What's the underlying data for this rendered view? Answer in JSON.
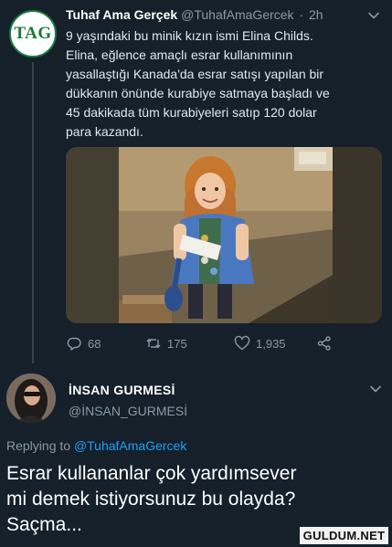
{
  "tweet1": {
    "avatar_text": "TAG",
    "name": "Tuhaf Ama Gerçek",
    "handle": "@TuhafAmaGercek",
    "separator": "·",
    "time": "2h",
    "text_lines": [
      "9 yaşındaki bu minik kızın ismi Elina Childs.",
      "Elina, eğlence amaçlı esrar kullanımının",
      "yasallaştığı Kanada'da esrar satışı yapılan bir",
      "dükkanın önünde kurabiye satmaya başladı ve",
      "45 dakikada tüm kurabiyeleri satıp 120 dolar",
      "para kazandı."
    ],
    "actions": {
      "replies": "68",
      "retweets": "175",
      "likes": "1,935"
    }
  },
  "tweet2": {
    "name": "İNSAN GURMESİ",
    "handle": "@İNSAN_GURMESİ",
    "replying_prefix": "Replying to",
    "replying_handle": "@TuhafAmaGercek",
    "text_lines": [
      "Esrar kullananlar çok yardımsever",
      "mi demek istiyorsunuz bu olayda?",
      "Saçma..."
    ]
  },
  "watermark": "GULDUM.NET",
  "colors": {
    "background": "#15202b",
    "secondary_text": "#8899a6",
    "link": "#1da1f2",
    "tag_green": "#1a7a3a"
  },
  "icons": [
    "chevron-down-icon",
    "reply-icon",
    "retweet-icon",
    "like-icon",
    "share-icon"
  ]
}
